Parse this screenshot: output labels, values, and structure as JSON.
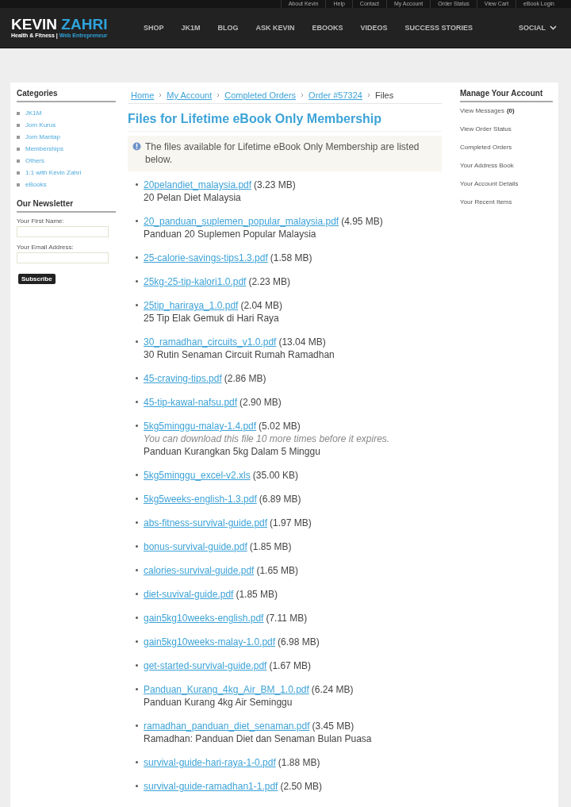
{
  "top_links": [
    "About Kevin",
    "Help",
    "Contact",
    "My Account",
    "Order Status",
    "View Cart",
    "eBook Login"
  ],
  "logo": {
    "name_a": "KEVIN",
    "name_b": "ZAHRI",
    "tagline_a": "Health & Fitness |",
    "tagline_b": "Web Entrepreneur"
  },
  "nav": [
    "SHOP",
    "JK1M",
    "BLOG",
    "ASK KEVIN",
    "EBOOKS",
    "VIDEOS",
    "SUCCESS STORIES"
  ],
  "nav_right": "SOCIAL",
  "categories": {
    "title": "Categories",
    "items": [
      "JK1M",
      "Jom Kurus",
      "Jom Mantap",
      "Memberships",
      "Others",
      "1:1 with Kevin Zahri",
      "eBooks"
    ]
  },
  "newsletter": {
    "title": "Our Newsletter",
    "fields": [
      {
        "label": "Your First Name:"
      },
      {
        "label": "Your Email Address:"
      }
    ],
    "button": "Subscribe"
  },
  "breadcrumb": [
    {
      "label": "Home",
      "link": true
    },
    {
      "label": "My Account",
      "link": true
    },
    {
      "label": "Completed Orders",
      "link": true
    },
    {
      "label": "Order #57324",
      "link": true
    },
    {
      "label": "Files",
      "link": false
    }
  ],
  "title": "Files for Lifetime eBook Only Membership",
  "notice": "The files available for Lifetime eBook Only Membership are listed below.",
  "files": [
    {
      "name": "20pelandiet_malaysia.pdf",
      "size": "(3.23 MB)",
      "description": "20 Pelan Diet Malaysia"
    },
    {
      "name": "20_panduan_suplemen_popular_malaysia.pdf",
      "size": "(4.95 MB)",
      "description": "Panduan 20 Suplemen Popular Malaysia"
    },
    {
      "name": "25-calorie-savings-tips1.3.pdf",
      "size": "(1.58 MB)"
    },
    {
      "name": "25kg-25-tip-kalori1.0.pdf",
      "size": "(2.23 MB)"
    },
    {
      "name": "25tip_hariraya_1.0.pdf",
      "size": "(2.04 MB)",
      "description": "25 Tip Elak Gemuk di Hari Raya"
    },
    {
      "name": "30_ramadhan_circuits_v1.0.pdf",
      "size": "(13.04 MB)",
      "description": "30 Rutin Senaman Circuit Rumah Ramadhan"
    },
    {
      "name": "45-craving-tips.pdf",
      "size": "(2.86 MB)"
    },
    {
      "name": "45-tip-kawal-nafsu.pdf",
      "size": "(2.90 MB)"
    },
    {
      "name": "5kg5minggu-malay-1.4.pdf",
      "size": "(5.02 MB)",
      "note": "You can download this file 10 more times before it expires.",
      "description": "Panduan Kurangkan 5kg Dalam 5 Minggu"
    },
    {
      "name": "5kg5minggu_excel-v2.xls",
      "size": "(35.00 KB)"
    },
    {
      "name": "5kg5weeks-english-1.3.pdf",
      "size": "(6.89 MB)"
    },
    {
      "name": "abs-fitness-survival-guide.pdf",
      "size": "(1.97 MB)"
    },
    {
      "name": "bonus-survival-guide.pdf",
      "size": "(1.85 MB)"
    },
    {
      "name": "calories-survival-guide.pdf",
      "size": "(1.65 MB)"
    },
    {
      "name": "diet-suvival-guide.pdf",
      "size": "(1.85 MB)"
    },
    {
      "name": "gain5kg10weeks-english.pdf",
      "size": "(7.11 MB)"
    },
    {
      "name": "gain5kg10weeks-malay-1.0.pdf",
      "size": "(6.98 MB)"
    },
    {
      "name": "get-started-survival-guide.pdf",
      "size": "(1.67 MB)"
    },
    {
      "name": "Panduan_Kurang_4kg_Air_BM_1.0.pdf",
      "size": "(6.24 MB)",
      "description": "Panduan Kurang 4kg Air Seminggu"
    },
    {
      "name": "ramadhan_panduan_diet_senaman.pdf",
      "size": "(3.45 MB)",
      "description": "Ramadhan: Panduan Diet dan Senaman Bulan Puasa"
    },
    {
      "name": "survival-guide-hari-raya-1-0.pdf",
      "size": "(1.88 MB)"
    },
    {
      "name": "survival-guide-ramadhan1-1.pdf",
      "size": "(2.50 MB)"
    }
  ],
  "account": {
    "title": "Manage Your Account",
    "items": [
      {
        "label": "View Messages",
        "count": "(0)"
      },
      {
        "label": "View Order Status"
      },
      {
        "label": "Completed Orders"
      },
      {
        "label": "Your Address Book"
      },
      {
        "label": "Your Account Details"
      },
      {
        "label": "Your Recent Items"
      }
    ]
  }
}
